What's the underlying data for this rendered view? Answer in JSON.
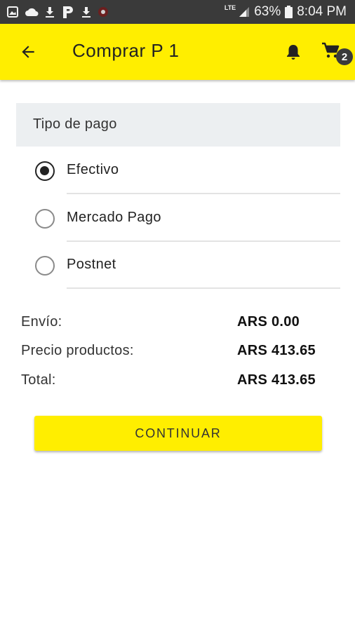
{
  "status_bar": {
    "left_icons": [
      "gallery-icon",
      "cloud-icon",
      "download-icon",
      "p-app-icon",
      "download-icon",
      "app-icon"
    ],
    "network": "LTE",
    "battery": "63%",
    "time": "8:04 PM"
  },
  "app_bar": {
    "title": "Comprar P 1",
    "cart_count": "2",
    "color": "#ffee00"
  },
  "payment": {
    "header": "Tipo de pago",
    "options": [
      {
        "label": "Efectivo",
        "selected": true
      },
      {
        "label": "Mercado Pago",
        "selected": false
      },
      {
        "label": "Postnet",
        "selected": false
      }
    ]
  },
  "summary": {
    "rows": [
      {
        "label": "Envío:",
        "value": "ARS 0.00"
      },
      {
        "label": "Precio productos:",
        "value": "ARS 413.65"
      },
      {
        "label": "Total:",
        "value": "ARS 413.65"
      }
    ]
  },
  "actions": {
    "continue_label": "CONTINUAR"
  }
}
